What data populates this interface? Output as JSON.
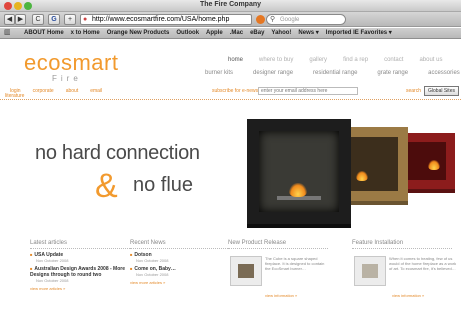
{
  "window": {
    "title": "The Fire Company"
  },
  "toolbar": {
    "back_label": "◀",
    "forward_label": "▶",
    "reload_label": "C",
    "stop_label": "G",
    "add_label": "+",
    "url": "http://www.ecosmartfire.com/USA/home.php",
    "search_placeholder": "Google"
  },
  "bookmarks": {
    "items": [
      "ABOUT Home",
      "x to Home",
      "Orange New Products",
      "Outlook",
      "Apple",
      ".Mac",
      "eBay",
      "Yahoo!",
      "News ▾",
      "Imported IE Favorites ▾"
    ]
  },
  "site": {
    "logo_main": "ecosmart",
    "logo_sub": "Fire",
    "brand_color": "#f29a2e",
    "topnav": [
      "home",
      "where to buy",
      "gallery",
      "find a rep",
      "contact",
      "about us"
    ],
    "subnav": [
      "burner kits",
      "designer range",
      "residential range",
      "grate range",
      "accessories"
    ],
    "util_links": [
      "login",
      "corporate",
      "about",
      "email"
    ],
    "util_extra": "literature",
    "subscribe_label": "subscribe for e-news",
    "email_placeholder": "enter your email address here",
    "search_label": "search",
    "search_button": "Global Sites"
  },
  "hero": {
    "line1": "no hard connection",
    "amp": "&",
    "line2": "no flue"
  },
  "columns": {
    "latest_articles": {
      "heading": "Latest articles",
      "items": [
        {
          "title": "USA Update",
          "date": "Nov October 2008"
        },
        {
          "title": "Australian Design Awards 2008 - More Designs through to round two",
          "date": "Nov October 2008"
        }
      ],
      "more": "view more articles »"
    },
    "recent_news": {
      "heading": "Recent News",
      "items": [
        {
          "title": "Dotson",
          "date": "Nov October 2008"
        },
        {
          "title": "Come on, Baby…",
          "date": "Nov October 2008"
        }
      ],
      "more": "view more articles »"
    },
    "new_product": {
      "heading": "New Product Release",
      "text": "The Cube is a square shaped fireplace. It is designed to contain the EcoSmart burner…",
      "more": "view information »"
    },
    "feature_installation": {
      "heading": "Feature Installation",
      "text": "When it comes to heating, few of us would of the home fireplace as a work of art. To ecosmart fire, it's believed…",
      "more": "view information »"
    }
  }
}
